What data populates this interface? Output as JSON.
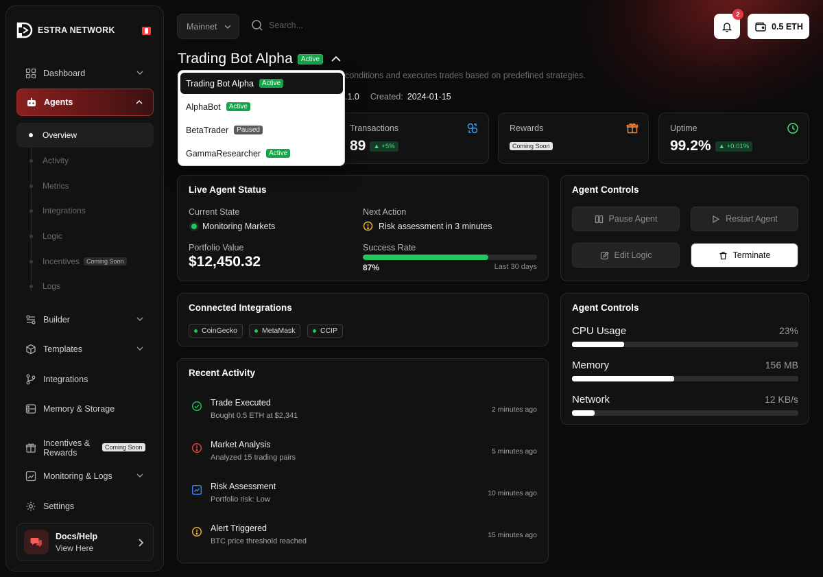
{
  "brand": {
    "name": "ESTRA NETWORK"
  },
  "sidebar": {
    "items": [
      {
        "label": "Dashboard",
        "icon": "grid-icon"
      },
      {
        "label": "Agents",
        "icon": "robot-icon"
      },
      {
        "label": "Builder",
        "icon": "builder-icon"
      },
      {
        "label": "Templates",
        "icon": "cube-icon"
      },
      {
        "label": "Integrations",
        "icon": "branch-icon"
      },
      {
        "label": "Memory & Storage",
        "icon": "storage-icon"
      },
      {
        "label": "Incentives &",
        "label2": "Rewards",
        "badge": "Coming Soon",
        "icon": "gift-icon"
      },
      {
        "label": "Monitoring & Logs",
        "icon": "chart-icon"
      },
      {
        "label": "Settings",
        "icon": "gear-icon"
      }
    ],
    "sub_items": [
      {
        "label": "Overview"
      },
      {
        "label": "Activity"
      },
      {
        "label": "Metrics"
      },
      {
        "label": "Integrations"
      },
      {
        "label": "Logic"
      },
      {
        "label": "Incentives",
        "badge": "Coming Soon"
      },
      {
        "label": "Logs"
      }
    ],
    "docs": {
      "title": "Docs/Help",
      "subtitle": "View Here"
    }
  },
  "topbar": {
    "network": "Mainnet",
    "search_placeholder": "Search...",
    "notifications": "2",
    "wallet": "0.5 ETH"
  },
  "agent": {
    "name": "Trading Bot Alpha",
    "status": "Active",
    "description": "conditions and executes trades based on predefined strategies.",
    "version_fragment": ".1.0",
    "created_label": "Created:",
    "created": "2024-01-15"
  },
  "dropdown": {
    "items": [
      {
        "name": "Trading Bot Alpha",
        "status": "Active"
      },
      {
        "name": "AlphaBot",
        "status": "Active"
      },
      {
        "name": "BetaTrader",
        "status": "Paused"
      },
      {
        "name": "GammaResearcher",
        "status": "Active"
      }
    ]
  },
  "stats": {
    "transactions": {
      "label": "Transactions",
      "value": "89",
      "delta": "+5%"
    },
    "rewards": {
      "label": "Rewards",
      "badge": "Coming Soon"
    },
    "uptime": {
      "label": "Uptime",
      "value": "99.2%",
      "delta": "+0.01%"
    }
  },
  "live_status": {
    "title": "Live Agent Status",
    "current_state_label": "Current State",
    "current_state": "Monitoring Markets",
    "next_action_label": "Next Action",
    "next_action": "Risk assessment in 3 minutes",
    "portfolio_label": "Portfolio Value",
    "portfolio_value": "$12,450.32",
    "success_label": "Success Rate",
    "success_value": "87%",
    "success_fraction": 0.72,
    "success_period": "Last 30 days"
  },
  "controls": {
    "title": "Agent Controls",
    "pause": "Pause Agent",
    "restart": "Restart Agent",
    "edit": "Edit Logic",
    "terminate": "Terminate"
  },
  "integrations": {
    "title": "Connected Integrations",
    "items": [
      "CoinGecko",
      "MetaMask",
      "CCIP"
    ]
  },
  "resources": {
    "title": "Agent Controls",
    "items": [
      {
        "label": "CPU Usage",
        "value": "23%",
        "fraction": 0.23
      },
      {
        "label": "Memory",
        "value": "156 MB",
        "fraction": 0.45
      },
      {
        "label": "Network",
        "value": "12 KB/s",
        "fraction": 0.1
      }
    ]
  },
  "activity": {
    "title": "Recent Activity",
    "items": [
      {
        "title": "Trade Executed",
        "sub": "Bought 0.5 ETH at $2,341",
        "time": "2 minutes ago",
        "icon": "check-circle-icon"
      },
      {
        "title": "Market Analysis",
        "sub": "Analyzed 15 trading pairs",
        "time": "5 minutes ago",
        "icon": "alert-circle-icon"
      },
      {
        "title": "Risk Assessment",
        "sub": "Portfolio risk: Low",
        "time": "10 minutes ago",
        "icon": "trend-icon"
      },
      {
        "title": "Alert Triggered",
        "sub": "BTC price threshold reached",
        "time": "15 minutes ago",
        "icon": "warning-icon"
      }
    ]
  },
  "colors": {
    "accent": "#8a2020",
    "success": "#22c55e",
    "background": "#0b0b0c",
    "panel": "#121213"
  }
}
